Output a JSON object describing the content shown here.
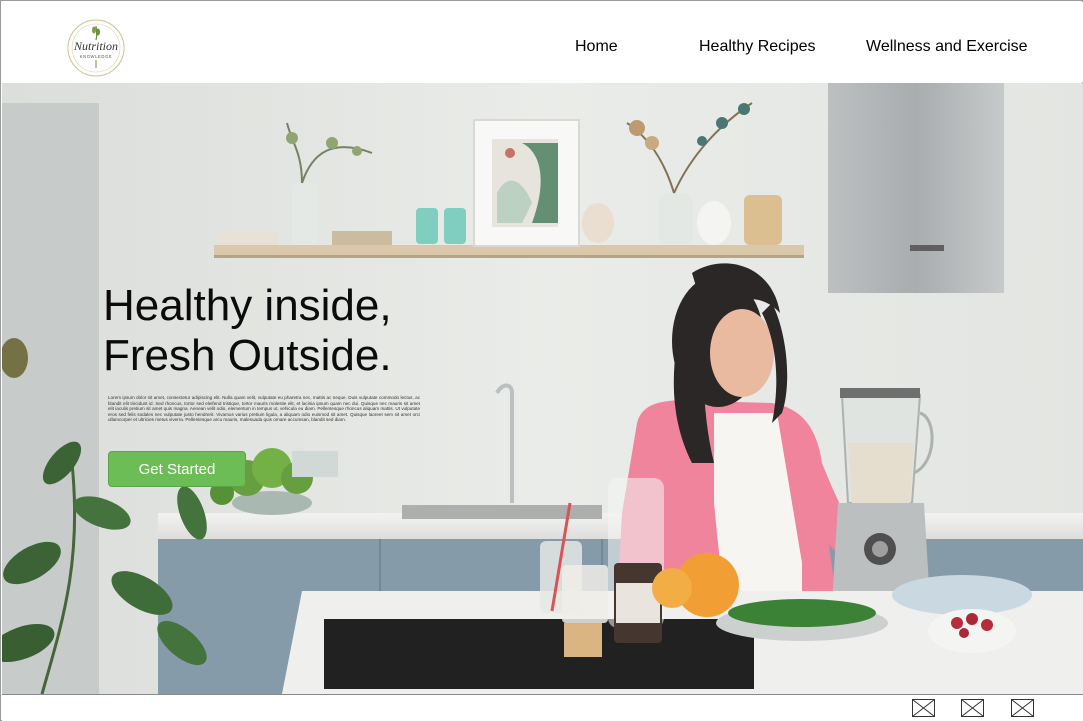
{
  "header": {
    "logo_text": "Nutrition",
    "logo_subtext": "KNOWLEDGE",
    "nav": {
      "home": "Home",
      "recipes": "Healthy Recipes",
      "wellness": "Wellness and Exercise"
    }
  },
  "hero": {
    "headline_line1": "Healthy inside,",
    "headline_line2": "Fresh Outside.",
    "body": "Lorem ipsum dolor sit amet, consectetur adipiscing elit. Nulla quam velit, vulputate eu pharetra nec, mattis ac neque. Duis vulputate commodo lectus, ac blandit elit tincidunt id. Sed rhoncus, tortor sed eleifend tristique, tortor mauris molestie elit, et lacinia ipsum quam nec dui. Quisque nec mauris sit amet elit iaculis pretium sit amet quis magna. Aenean velit odio, elementum in tempus ut, vehicula eu diam. Pellentesque rhoncus aliquam mattis. Ut vulputate eros sed felis sodales nec vulputate justo hendrerit. Vivamus varius pretium ligula, a aliquam odio euismod sit amet. Quisque laoreet sem sit amet orci ullamcorper et ultricies metus viverra. Pellentesque arcu mauris, malesuada quis ornare accumsan, blandit sed diam.",
    "cta_label": "Get Started"
  },
  "footer": {
    "icons": [
      "envelope-icon",
      "envelope-icon",
      "envelope-icon"
    ]
  },
  "colors": {
    "cta": "#6cbd55",
    "header_bg": "#ffffff",
    "text": "#0b0b0b"
  }
}
